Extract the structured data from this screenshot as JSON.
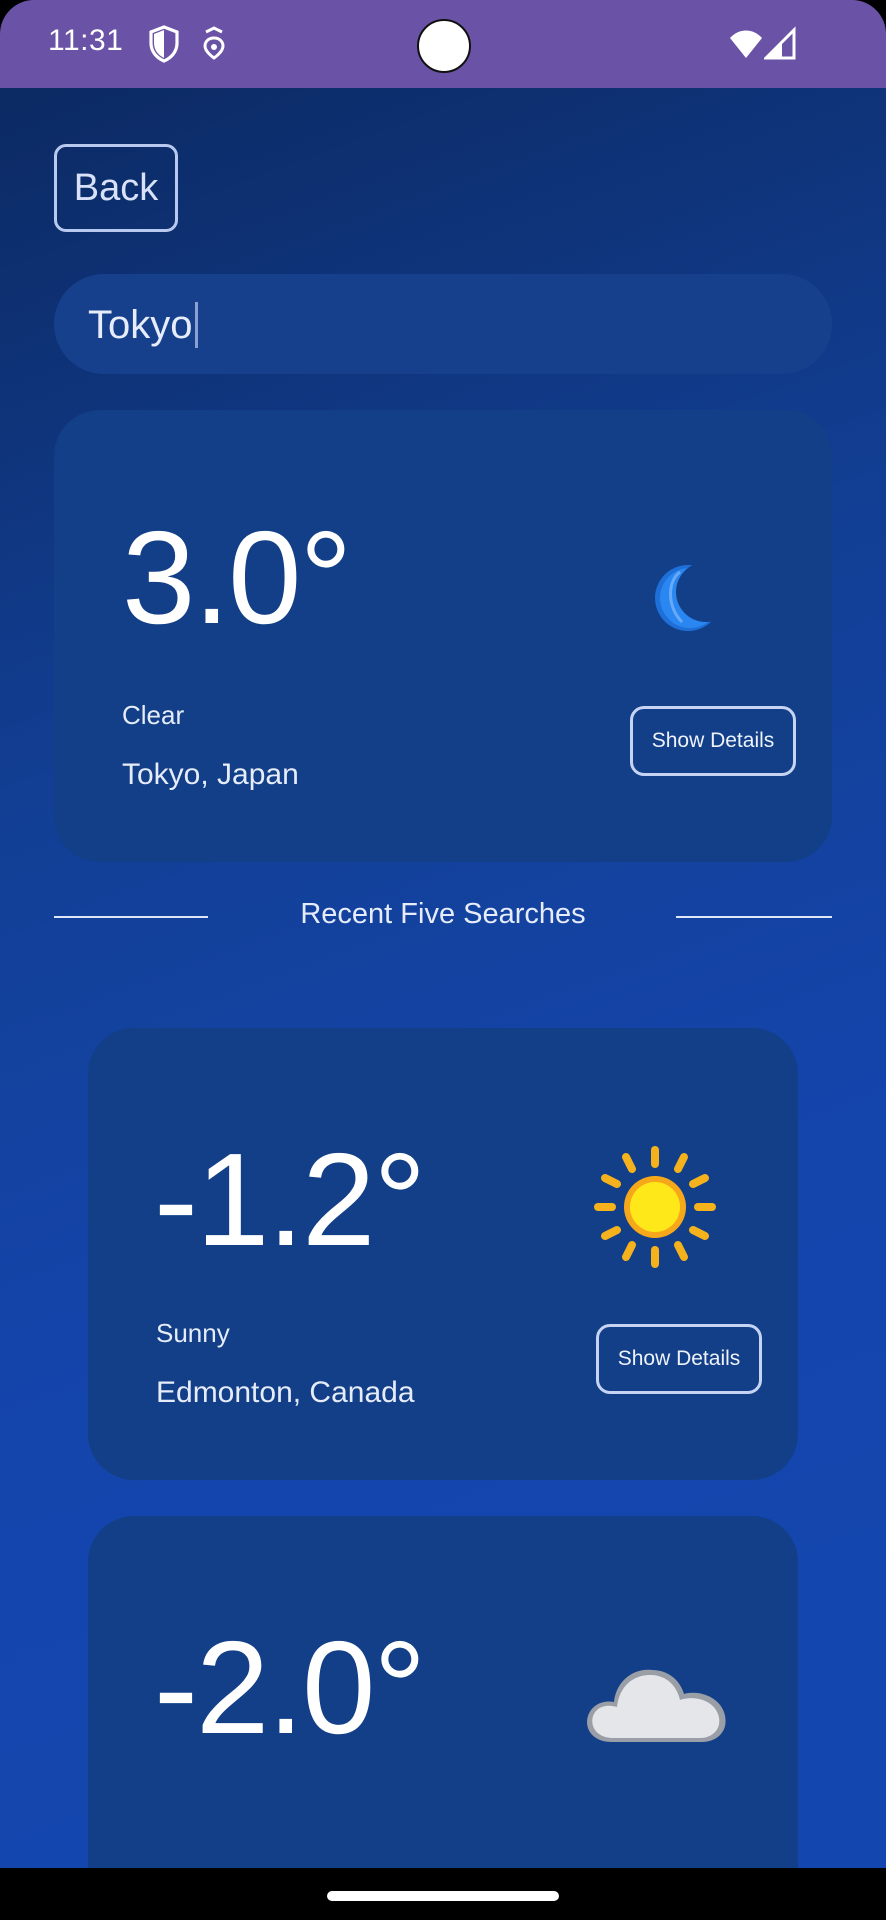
{
  "status_bar": {
    "time": "11:31",
    "icons": [
      "shield-icon",
      "data-saver-icon",
      "wifi-icon",
      "signal-icon"
    ],
    "color": "#6a52a6"
  },
  "header": {
    "back_label": "Back"
  },
  "search": {
    "value": "Tokyo"
  },
  "current": {
    "temperature": "3.0°",
    "condition": "Clear",
    "location": "Tokyo, Japan",
    "icon": "moon-icon",
    "details_label": "Show Details"
  },
  "recent": {
    "title": "Recent Five Searches",
    "items": [
      {
        "temperature": "-1.2°",
        "condition": "Sunny",
        "location": "Edmonton, Canada",
        "icon": "sun-icon",
        "details_label": "Show Details"
      },
      {
        "temperature": "-2.0°",
        "icon": "cloud-icon"
      }
    ]
  },
  "colors": {
    "background_top": "#0c2a63",
    "background_bottom": "#1446b0",
    "card": "#123f87"
  }
}
